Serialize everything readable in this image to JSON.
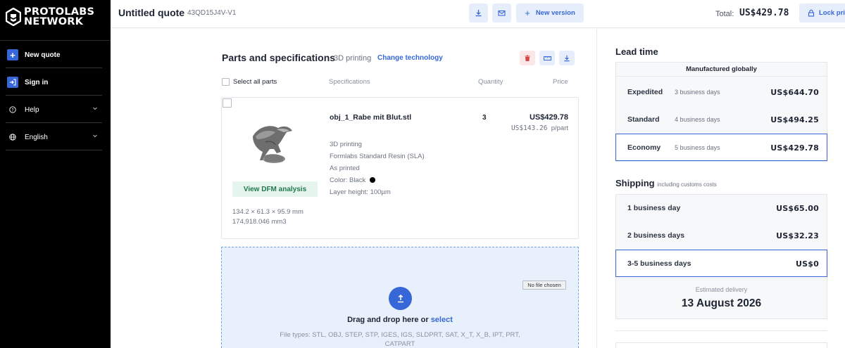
{
  "sidebar": {
    "brand_line1": "PROTOLABS",
    "brand_line2": "NETWORK",
    "items": [
      {
        "label": "New quote",
        "icon": "plus-icon"
      },
      {
        "label": "Sign in",
        "icon": "sign-in-icon"
      },
      {
        "label": "Help",
        "icon": "help-circle-icon"
      },
      {
        "label": "English",
        "icon": "globe-icon"
      }
    ]
  },
  "header": {
    "title": "Untitled quote",
    "quote_id": "43QD15J4V-V1",
    "new_version_label": "New version",
    "total_label": "Total:",
    "total_value": "US$429.78",
    "lock_label": "Lock pri"
  },
  "parts": {
    "title": "Parts and specifications",
    "technology": "3D printing",
    "change_link": "Change technology",
    "select_all": "Select all parts",
    "columns": {
      "specifications": "Specifications",
      "quantity": "Quantity",
      "price": "Price"
    },
    "item": {
      "name": "obj_1_Rabe mit Blut.stl",
      "quantity": "3",
      "price": "US$429.78",
      "unit_price": "US$143.26",
      "unit_suffix": "p/part",
      "specs": [
        "3D printing",
        "Formlabs Standard Resin (SLA)",
        "As printed",
        "Color: Black",
        "Layer height: 100µm"
      ],
      "dfm_label": "View DFM analysis",
      "dimensions": "134.2 × 61.3 × 95.9 mm",
      "volume": "174,918.046 mm3"
    }
  },
  "upload": {
    "drop_text": "Drag and drop here or",
    "select_link": "select",
    "file_types": "File types: STL, OBJ, STEP, STP, IGES, IGS, SLDPRT, SAT, X_T, X_B, IPT, PRT, CATPART",
    "no_file": "No file chosen"
  },
  "lead_time": {
    "title": "Lead time",
    "header": "Manufactured globally",
    "options": [
      {
        "name": "Expedited",
        "days": "3 business days",
        "price": "US$644.70",
        "selected": false
      },
      {
        "name": "Standard",
        "days": "4 business days",
        "price": "US$494.25",
        "selected": false
      },
      {
        "name": "Economy",
        "days": "5 business days",
        "price": "US$429.78",
        "selected": true
      }
    ]
  },
  "shipping": {
    "title": "Shipping",
    "subtitle": "including customs costs",
    "options": [
      {
        "name": "1 business day",
        "price": "US$65.00",
        "selected": false
      },
      {
        "name": "2 business days",
        "price": "US$32.23",
        "selected": false
      },
      {
        "name": "3-5 business days",
        "price": "US$0",
        "selected": true
      }
    ],
    "estimated_label": "Estimated delivery",
    "estimated_date": "13 August 2026"
  },
  "colors": {
    "accent": "#3767d6",
    "sidebar": "#000000",
    "dfm_green": "#1f7a4d",
    "danger": "#d64545"
  }
}
